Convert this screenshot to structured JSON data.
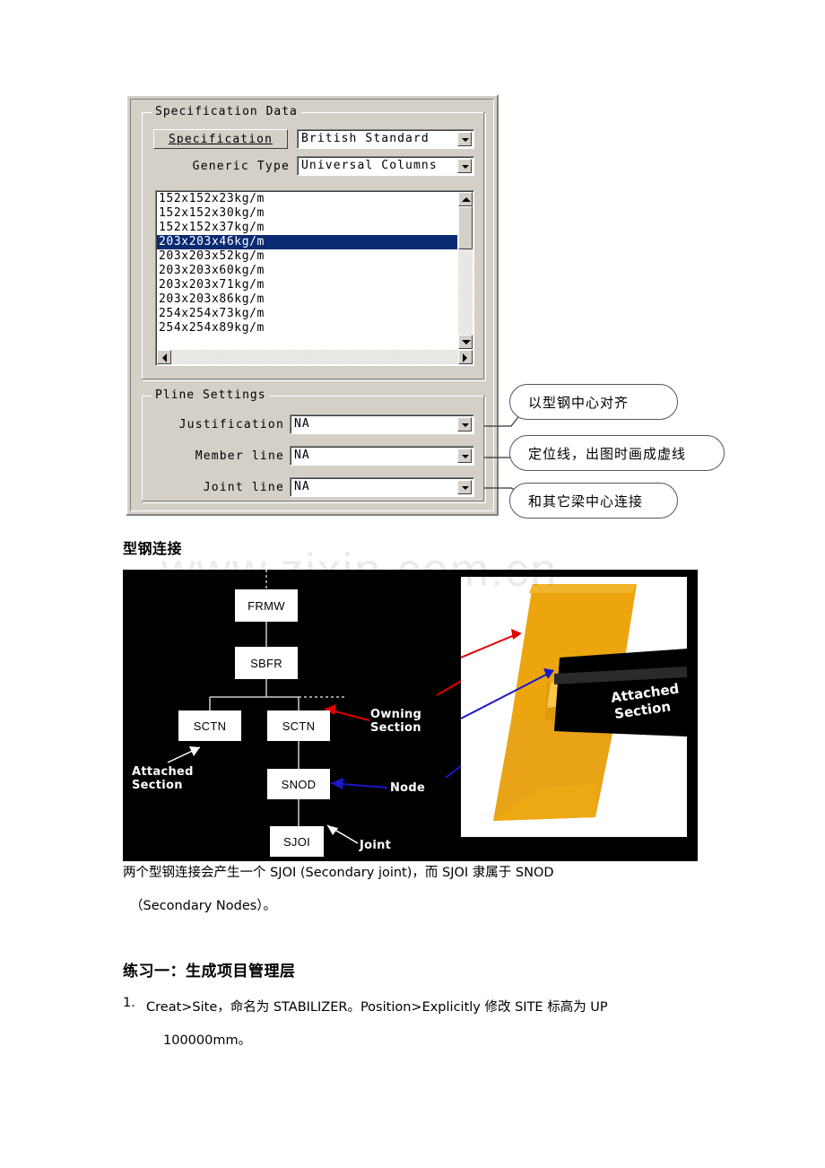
{
  "dialog": {
    "spec_group": {
      "title": "Specification Data",
      "spec_button": "Specification",
      "spec_value": "British Standard",
      "generic_label": "Generic Type",
      "generic_value": "Universal Columns",
      "list_items": [
        "152x152x23kg/m",
        "152x152x30kg/m",
        "152x152x37kg/m",
        "203x203x46kg/m",
        "203x203x52kg/m",
        "203x203x60kg/m",
        "203x203x71kg/m",
        "203x203x86kg/m",
        "254x254x73kg/m",
        "254x254x89kg/m"
      ],
      "selected_index": 3,
      "selected_value": "203x203x46kg/m"
    },
    "pline_group": {
      "title": "Pline Settings",
      "rows": [
        {
          "label": "Justification",
          "value": "NA"
        },
        {
          "label": "Member line",
          "value": "NA"
        },
        {
          "label": "Joint line",
          "value": "NA"
        }
      ]
    }
  },
  "callouts": [
    {
      "text": "以型钢中心对齐"
    },
    {
      "text": "定位线，出图时画成虚线"
    },
    {
      "text": "和其它梁中心连接"
    }
  ],
  "section": {
    "heading": "型钢连接",
    "watermark": "www.zixin.com.cn"
  },
  "diagram": {
    "nodes": [
      {
        "id": "FRMW",
        "label": "FRMW"
      },
      {
        "id": "SBFR",
        "label": "SBFR"
      },
      {
        "id": "SCTN_L",
        "label": "SCTN"
      },
      {
        "id": "SCTN_R",
        "label": "SCTN"
      },
      {
        "id": "SNOD",
        "label": "SNOD"
      },
      {
        "id": "SJOI",
        "label": "SJOI"
      }
    ],
    "labels": {
      "owning_section": "Owning\nSection",
      "owning_section_l1": "Owning",
      "owning_section_l2": "Section",
      "attached_section_l1": "Attached",
      "attached_section_l2": "Section",
      "node": "Node",
      "joint": "Joint",
      "render_attached_l1": "Attached",
      "render_attached_l2": "Section"
    },
    "colors": {
      "owning_arrow": "#e00000",
      "node_arrow": "#1818c8",
      "beam": "#e8a317",
      "background": "#000000"
    }
  },
  "body": {
    "paragraph_line1": "两个型钢连接会产生一个 SJOI (Secondary joint)，而 SJOI 隶属于 SNOD",
    "paragraph_line2": "（Secondary Nodes）。",
    "exercise_heading": "练习一：生成项目管理层",
    "item1_number": "1.",
    "item1_line1": "Creat>Site，命名为 STABILIZER。Position>Explicitly 修改 SITE 标高为 UP",
    "item1_line2": "100000mm。"
  }
}
